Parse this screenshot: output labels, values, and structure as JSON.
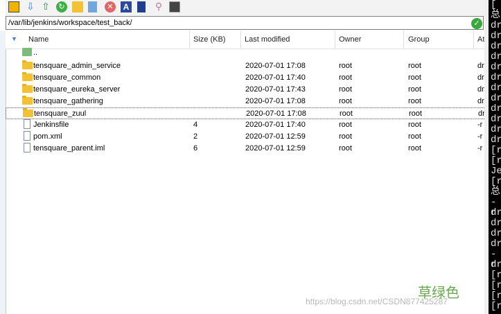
{
  "toolbar": {
    "icons": [
      "parent-folder-icon",
      "download-icon",
      "upload-icon",
      "refresh-icon",
      "new-folder-icon",
      "new-file-icon",
      "delete-icon",
      "rename-icon",
      "edit-icon",
      "properties-icon",
      "terminal-icon"
    ]
  },
  "path": {
    "value": "/var/lib/jenkins/workspace/test_back/"
  },
  "columns": {
    "name": "Name",
    "size": "Size (KB)",
    "modified": "Last modified",
    "owner": "Owner",
    "group": "Group",
    "attr": "At"
  },
  "rows": [
    {
      "type": "parent",
      "name": "..",
      "size": "",
      "modified": "",
      "owner": "",
      "group": "",
      "attr": ""
    },
    {
      "type": "folder",
      "name": "tensquare_admin_service",
      "size": "",
      "modified": "2020-07-01 17:08",
      "owner": "root",
      "group": "root",
      "attr": "dr"
    },
    {
      "type": "folder",
      "name": "tensquare_common",
      "size": "",
      "modified": "2020-07-01 17:40",
      "owner": "root",
      "group": "root",
      "attr": "dr"
    },
    {
      "type": "folder",
      "name": "tensquare_eureka_server",
      "size": "",
      "modified": "2020-07-01 17:43",
      "owner": "root",
      "group": "root",
      "attr": "dr"
    },
    {
      "type": "folder",
      "name": "tensquare_gathering",
      "size": "",
      "modified": "2020-07-01 17:08",
      "owner": "root",
      "group": "root",
      "attr": "dr"
    },
    {
      "type": "folder",
      "name": "tensquare_zuul",
      "size": "",
      "modified": "2020-07-01 17:08",
      "owner": "root",
      "group": "root",
      "attr": "dr"
    },
    {
      "type": "file",
      "name": "Jenkinsfile",
      "size": "4",
      "modified": "2020-07-01 17:40",
      "owner": "root",
      "group": "root",
      "attr": "-r"
    },
    {
      "type": "file",
      "name": "pom.xml",
      "size": "2",
      "modified": "2020-07-01 12:59",
      "owner": "root",
      "group": "root",
      "attr": "-r"
    },
    {
      "type": "file",
      "name": "tensquare_parent.iml",
      "size": "6",
      "modified": "2020-07-01 12:59",
      "owner": "root",
      "group": "root",
      "attr": "-r"
    }
  ],
  "terminal": {
    "lines": [
      "[",
      "总",
      "dr",
      "dr",
      "dr",
      "dr",
      "dr",
      "dr",
      "dr",
      "dr",
      "dr",
      "dr",
      "dr",
      "dr",
      "[r",
      "[r",
      "Je",
      "[r",
      "总",
      "-r",
      "dr",
      "dr",
      "dr",
      "dr",
      "-r",
      "dr",
      "[r",
      "[r",
      "[r",
      "[r"
    ]
  },
  "watermark": {
    "label": "草绿色",
    "url": "https://blog.csdn.net/CSDN877425287"
  }
}
